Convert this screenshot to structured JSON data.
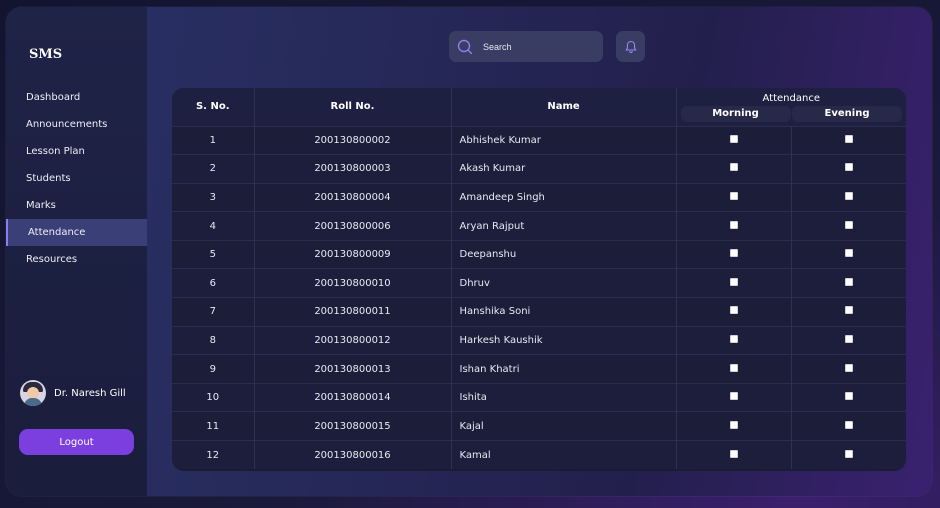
{
  "sidebar": {
    "logo": "SMS",
    "items": [
      {
        "label": "Dashboard"
      },
      {
        "label": "Announcements"
      },
      {
        "label": "Lesson Plan"
      },
      {
        "label": "Students"
      },
      {
        "label": "Marks"
      },
      {
        "label": "Attendance",
        "active": true
      },
      {
        "label": "Resources"
      }
    ],
    "profile_name": "Dr. Naresh Gill",
    "logout_label": "Logout"
  },
  "header": {
    "search_placeholder": "Search",
    "search_icon": "search-icon",
    "bell_icon": "bell-icon"
  },
  "table": {
    "headers": {
      "sno": "S. No.",
      "roll": "Roll No.",
      "name": "Name",
      "attendance": "Attendance",
      "morning": "Morning",
      "evening": "Evening"
    },
    "rows": [
      {
        "sno": "1",
        "roll": "200130800002",
        "name": "Abhishek Kumar",
        "morning": false,
        "evening": false
      },
      {
        "sno": "2",
        "roll": "200130800003",
        "name": "Akash Kumar",
        "morning": false,
        "evening": false
      },
      {
        "sno": "3",
        "roll": "200130800004",
        "name": "Amandeep Singh",
        "morning": false,
        "evening": false
      },
      {
        "sno": "4",
        "roll": "200130800006",
        "name": "Aryan Rajput",
        "morning": false,
        "evening": false
      },
      {
        "sno": "5",
        "roll": "200130800009",
        "name": "Deepanshu",
        "morning": false,
        "evening": false
      },
      {
        "sno": "6",
        "roll": "200130800010",
        "name": "Dhruv",
        "morning": false,
        "evening": false
      },
      {
        "sno": "7",
        "roll": "200130800011",
        "name": "Hanshika Soni",
        "morning": false,
        "evening": false
      },
      {
        "sno": "8",
        "roll": "200130800012",
        "name": "Harkesh Kaushik",
        "morning": false,
        "evening": false
      },
      {
        "sno": "9",
        "roll": "200130800013",
        "name": "Ishan Khatri",
        "morning": false,
        "evening": false
      },
      {
        "sno": "10",
        "roll": "200130800014",
        "name": "Ishita",
        "morning": false,
        "evening": false
      },
      {
        "sno": "11",
        "roll": "200130800015",
        "name": "Kajal",
        "morning": false,
        "evening": false
      },
      {
        "sno": "12",
        "roll": "200130800016",
        "name": "Kamal",
        "morning": false,
        "evening": false
      }
    ]
  },
  "colors": {
    "accent": "#7b3fe0",
    "active_nav": "#3b3f78",
    "sidebar_bg": "#1f2347",
    "table_bg": "#1a1c36"
  }
}
